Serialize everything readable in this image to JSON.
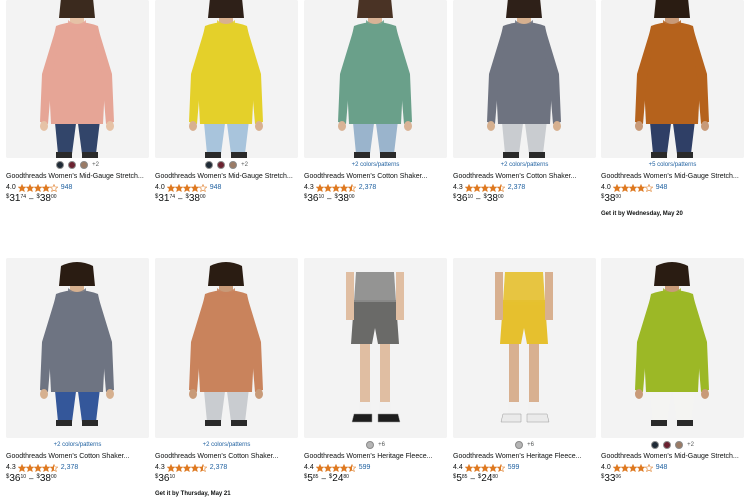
{
  "colors": {
    "bg": "#ffffff",
    "image_bg": "#f3f3f3",
    "link": "#2162a1",
    "star": "#de7921",
    "text": "#0f1111"
  },
  "products": [
    {
      "title": "Goodthreads Women's Mid-Gauge Stretch...",
      "rating": "4.0",
      "stars": 4,
      "reviews": "948",
      "swatches": [
        "#1f2a36",
        "#6b2230",
        "#9a7b66"
      ],
      "swatch_more": "+2",
      "colors_link": "",
      "price_low": {
        "cur": "$",
        "whole": "31",
        "frac": "74"
      },
      "price_high": {
        "cur": "$",
        "whole": "38",
        "frac": "00"
      },
      "delivery": "",
      "sweater_color": "#e6a596",
      "bottom_color": "#32456a",
      "skin": "#e6c2a6",
      "hair": "#3b2a1e",
      "kind": "sweater"
    },
    {
      "title": "Goodthreads Women's Mid-Gauge Stretch...",
      "rating": "4.0",
      "stars": 4,
      "reviews": "948",
      "swatches": [
        "#1f2a36",
        "#6b2230",
        "#9a7b66"
      ],
      "swatch_more": "+2",
      "colors_link": "",
      "price_low": {
        "cur": "$",
        "whole": "31",
        "frac": "74"
      },
      "price_high": {
        "cur": "$",
        "whole": "38",
        "frac": "00"
      },
      "delivery": "",
      "sweater_color": "#e4d02a",
      "bottom_color": "#a8c4dc",
      "skin": "#d8b090",
      "hair": "#2e2018",
      "kind": "sweater"
    },
    {
      "title": "Goodthreads Women's Cotton Shaker...",
      "rating": "4.3",
      "stars": 4.5,
      "reviews": "2,378",
      "swatches": [],
      "swatch_more": "",
      "colors_link": "+2 colors/patterns",
      "price_low": {
        "cur": "$",
        "whole": "36",
        "frac": "10"
      },
      "price_high": {
        "cur": "$",
        "whole": "38",
        "frac": "00"
      },
      "delivery": "",
      "sweater_color": "#6aa08a",
      "bottom_color": "#9ab4cc",
      "skin": "#d9b396",
      "hair": "#4a3325",
      "kind": "sweater"
    },
    {
      "title": "Goodthreads Women's Cotton Shaker...",
      "rating": "4.3",
      "stars": 4.5,
      "reviews": "2,378",
      "swatches": [],
      "swatch_more": "",
      "colors_link": "+2 colors/patterns",
      "price_low": {
        "cur": "$",
        "whole": "36",
        "frac": "10"
      },
      "price_high": {
        "cur": "$",
        "whole": "38",
        "frac": "00"
      },
      "delivery": "",
      "sweater_color": "#6e7380",
      "bottom_color": "#c9ccd0",
      "skin": "#d6b08f",
      "hair": "#2e2018",
      "kind": "sweater"
    },
    {
      "title": "Goodthreads Women's Mid-Gauge Stretch...",
      "rating": "4.0",
      "stars": 4,
      "reviews": "948",
      "swatches": [],
      "swatch_more": "",
      "colors_link": "+5 colors/patterns",
      "price_low": {
        "cur": "$",
        "whole": "38",
        "frac": "00"
      },
      "price_high": null,
      "delivery": "Get it by Wednesday, May 20",
      "sweater_color": "#b5621c",
      "bottom_color": "#2f3f66",
      "skin": "#c89a78",
      "hair": "#2a1c12",
      "kind": "sweater"
    },
    {
      "title": "Goodthreads Women's Cotton Shaker...",
      "rating": "4.3",
      "stars": 4.5,
      "reviews": "2,378",
      "swatches": [],
      "swatch_more": "",
      "colors_link": "+2 colors/patterns",
      "price_low": {
        "cur": "$",
        "whole": "36",
        "frac": "10"
      },
      "price_high": {
        "cur": "$",
        "whole": "38",
        "frac": "00"
      },
      "delivery": "",
      "sweater_color": "#6e7482",
      "bottom_color": "#34579a",
      "skin": "#d6b08f",
      "hair": "#2a1c12",
      "kind": "sweater"
    },
    {
      "title": "Goodthreads Women's Cotton Shaker...",
      "rating": "4.3",
      "stars": 4.5,
      "reviews": "2,378",
      "swatches": [],
      "swatch_more": "",
      "colors_link": "+2 colors/patterns",
      "price_low": {
        "cur": "$",
        "whole": "36",
        "frac": "10"
      },
      "price_high": null,
      "delivery": "Get it by Thursday, May 21",
      "sweater_color": "#c9835c",
      "bottom_color": "#c9ccd0",
      "skin": "#c89a78",
      "hair": "#2a1c12",
      "kind": "sweater"
    },
    {
      "title": "Goodthreads Women's Heritage Fleece...",
      "rating": "4.4",
      "stars": 4.5,
      "reviews": "599",
      "swatches": [
        "#b5b5b5"
      ],
      "swatch_more": "+6",
      "colors_link": "",
      "price_low": {
        "cur": "$",
        "whole": "5",
        "frac": "85"
      },
      "price_high": {
        "cur": "$",
        "whole": "24",
        "frac": "80"
      },
      "delivery": "",
      "sweater_color": "#8a8a88",
      "bottom_color": "#6a6a68",
      "skin": "#e0bea2",
      "hair": "#2e2018",
      "kind": "shorts"
    },
    {
      "title": "Goodthreads Women's Heritage Fleece...",
      "rating": "4.4",
      "stars": 4.5,
      "reviews": "599",
      "swatches": [
        "#b5b5b5"
      ],
      "swatch_more": "+6",
      "colors_link": "",
      "price_low": {
        "cur": "$",
        "whole": "5",
        "frac": "85"
      },
      "price_high": {
        "cur": "$",
        "whole": "24",
        "frac": "80"
      },
      "delivery": "",
      "sweater_color": "#e6c02e",
      "bottom_color": "#e6c02e",
      "skin": "#d8b090",
      "hair": "#2e2018",
      "kind": "shorts"
    },
    {
      "title": "Goodthreads Women's Mid-Gauge Stretch...",
      "rating": "4.0",
      "stars": 4,
      "reviews": "948",
      "swatches": [
        "#1f2a36",
        "#6b2230",
        "#9a7b66"
      ],
      "swatch_more": "+2",
      "colors_link": "",
      "price_low": {
        "cur": "$",
        "whole": "33",
        "frac": "06"
      },
      "price_high": null,
      "delivery": "",
      "sweater_color": "#9cb826",
      "bottom_color": "#f4f4f2",
      "skin": "#c89a78",
      "hair": "#2a1c12",
      "kind": "sweater"
    }
  ]
}
